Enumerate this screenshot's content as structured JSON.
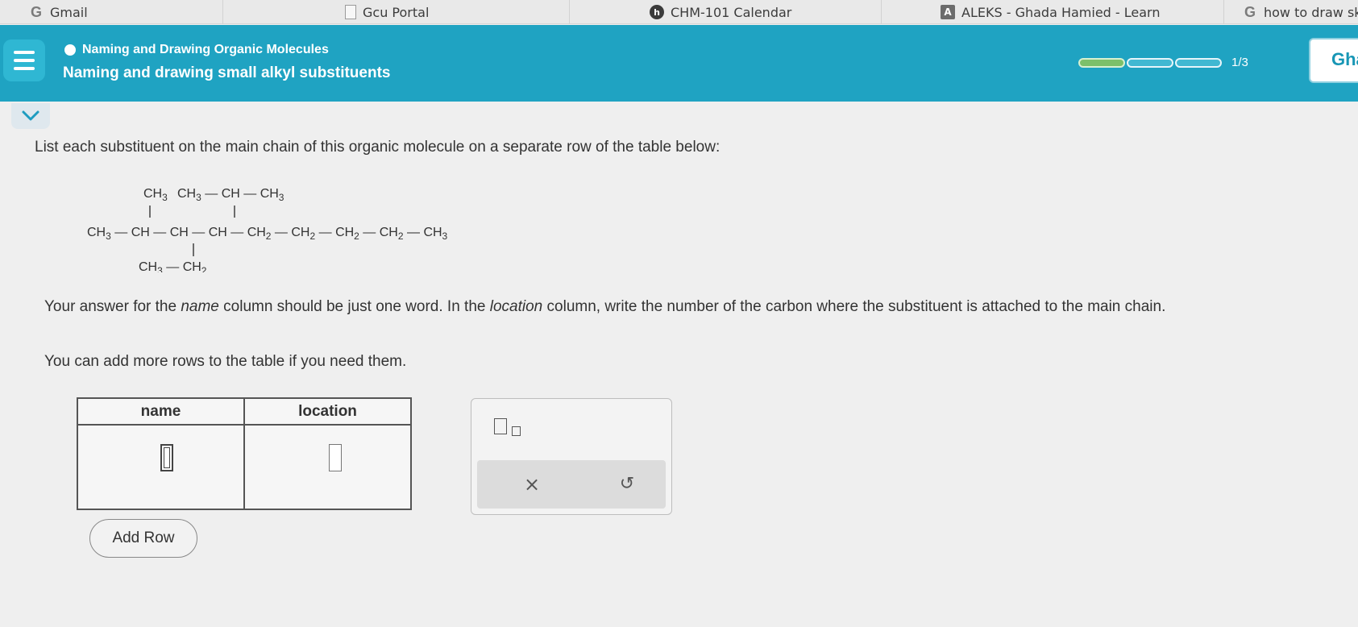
{
  "bookmarks": [
    {
      "label": "Gmail",
      "icon": "google-icon"
    },
    {
      "label": "Gcu Portal",
      "icon": "document-icon"
    },
    {
      "label": "CHM-101 Calendar",
      "icon": "calendar-app-icon"
    },
    {
      "label": "ALEKS - Ghada Hamied - Learn",
      "icon": "aleks-icon"
    },
    {
      "label": "how to draw ske",
      "icon": "google-icon"
    }
  ],
  "header": {
    "topic": "Naming and Drawing Organic Molecules",
    "subtitle": "Naming and drawing small alkyl substituents",
    "progress_text": "1/3",
    "progress_completed": 1,
    "progress_total": 3,
    "user_label": "Gha",
    "accent_color": "#1fa3c2"
  },
  "question": {
    "instruction": "List each substituent on the main chain of this organic molecule on a separate row of the table below:",
    "molecule": {
      "top_left": "CH3",
      "top_right": "CH3 — CH — CH3",
      "main_chain": "CH3 — CH — CH — CH — CH2 — CH2 — CH2 — CH2 — CH3",
      "bottom": "CH3 — CH2"
    },
    "para1_a": "Your answer for the ",
    "para1_name": "name",
    "para1_b": " column should be just one word. In the ",
    "para1_location": "location",
    "para1_c": " column, write the number of the carbon where the substituent is attached to the main chain.",
    "para2": "You can add more rows to the table if you need them."
  },
  "table": {
    "headers": [
      "name",
      "location"
    ],
    "rows": [
      {
        "name": "",
        "location": ""
      }
    ]
  },
  "tools": {
    "clear_label": "×",
    "undo_label": "↺"
  },
  "add_row_label": "Add Row"
}
